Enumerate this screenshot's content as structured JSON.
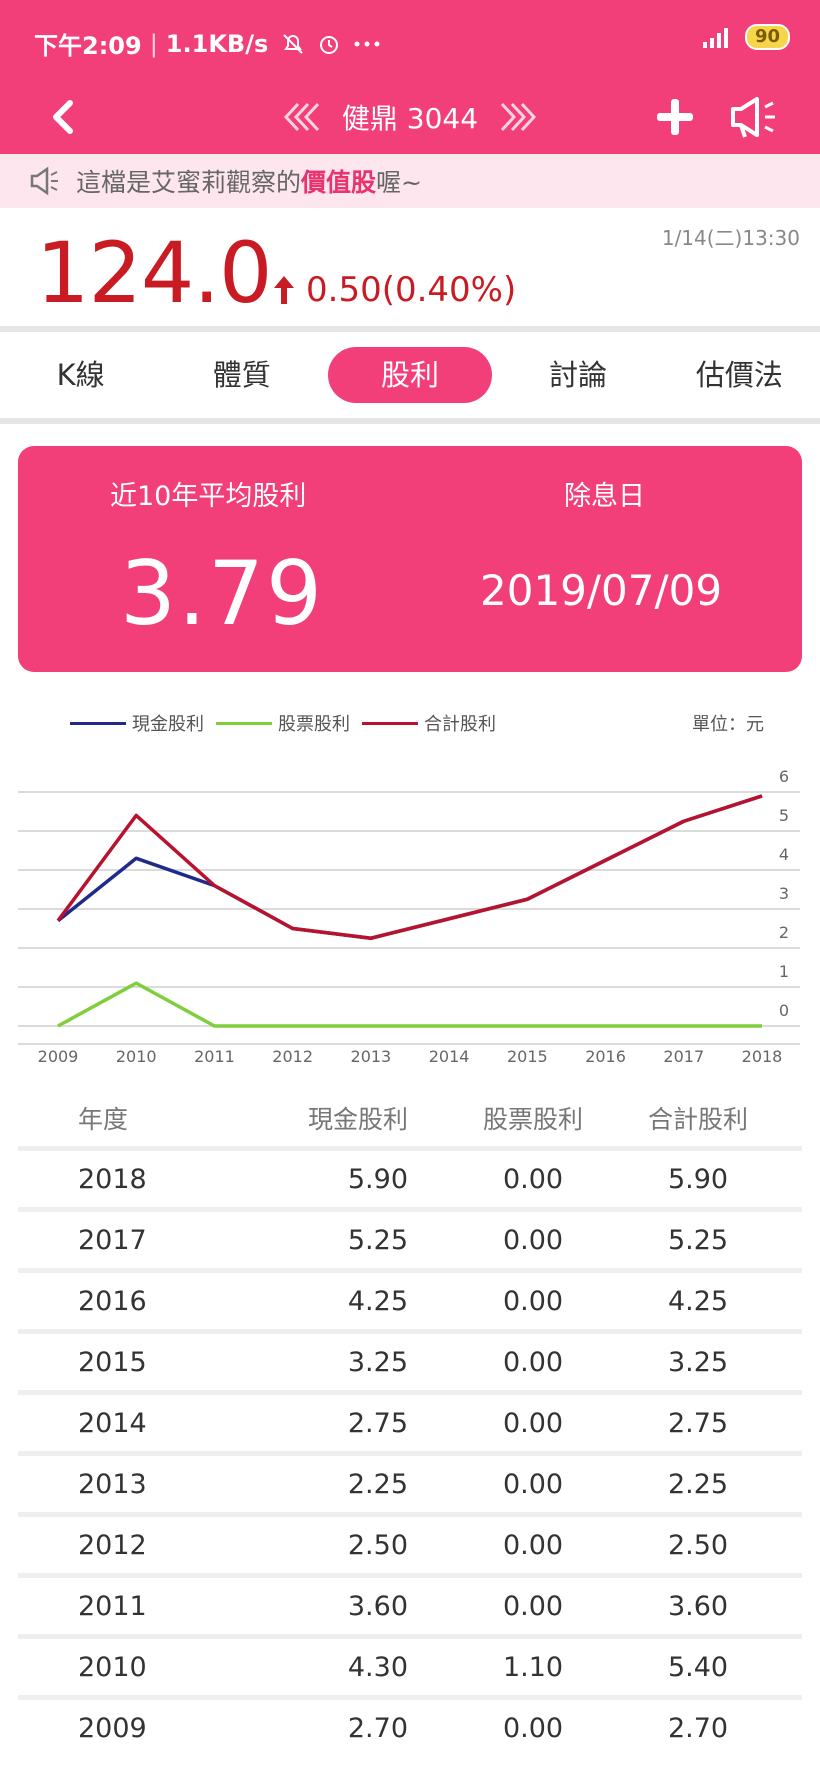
{
  "statusbar": {
    "time": "下午2:09",
    "speed": "1.1KB/s",
    "battery": "90"
  },
  "header": {
    "stock": "健鼎 3044"
  },
  "banner": {
    "prefix": "這檔是艾蜜莉觀察的",
    "highlight": "價值股",
    "suffix": "喔~"
  },
  "quote": {
    "price": "124.0",
    "change": "0.50(0.40%)",
    "timestamp": "1/14(二)13:30"
  },
  "tabs": [
    "K線",
    "體質",
    "股利",
    "討論",
    "估價法"
  ],
  "summary": {
    "avg_label": "近10年平均股利",
    "avg_value": "3.79",
    "exdiv_label": "除息日",
    "exdiv_value": "2019/07/09"
  },
  "legend": {
    "cash": "現金股利",
    "stock": "股票股利",
    "total": "合計股利",
    "unit": "單位：元"
  },
  "colors": {
    "accent": "#f23f7a",
    "up": "#c91b23",
    "cash": "#1f2a8a",
    "stock": "#7fce3c",
    "total": "#b8122e"
  },
  "chart_data": {
    "type": "line",
    "x": [
      "2009",
      "2010",
      "2011",
      "2012",
      "2013",
      "2014",
      "2015",
      "2016",
      "2017",
      "2018"
    ],
    "ylim": [
      0,
      6
    ],
    "yticks": [
      "0",
      "1",
      "2",
      "3",
      "4",
      "5",
      "6"
    ],
    "series": [
      {
        "name": "現金股利",
        "values": [
          2.7,
          4.3,
          3.6,
          2.5,
          2.25,
          2.75,
          3.25,
          4.25,
          5.25,
          5.9
        ]
      },
      {
        "name": "股票股利",
        "values": [
          0.0,
          1.1,
          0.0,
          0.0,
          0.0,
          0.0,
          0.0,
          0.0,
          0.0,
          0.0
        ]
      },
      {
        "name": "合計股利",
        "values": [
          2.7,
          5.4,
          3.6,
          2.5,
          2.25,
          2.75,
          3.25,
          4.25,
          5.25,
          5.9
        ]
      }
    ]
  },
  "table": {
    "headers": [
      "年度",
      "現金股利",
      "股票股利",
      "合計股利"
    ],
    "rows": [
      [
        "2018",
        "5.90",
        "0.00",
        "5.90"
      ],
      [
        "2017",
        "5.25",
        "0.00",
        "5.25"
      ],
      [
        "2016",
        "4.25",
        "0.00",
        "4.25"
      ],
      [
        "2015",
        "3.25",
        "0.00",
        "3.25"
      ],
      [
        "2014",
        "2.75",
        "0.00",
        "2.75"
      ],
      [
        "2013",
        "2.25",
        "0.00",
        "2.25"
      ],
      [
        "2012",
        "2.50",
        "0.00",
        "2.50"
      ],
      [
        "2011",
        "3.60",
        "0.00",
        "3.60"
      ],
      [
        "2010",
        "4.30",
        "1.10",
        "5.40"
      ],
      [
        "2009",
        "2.70",
        "0.00",
        "2.70"
      ]
    ]
  }
}
